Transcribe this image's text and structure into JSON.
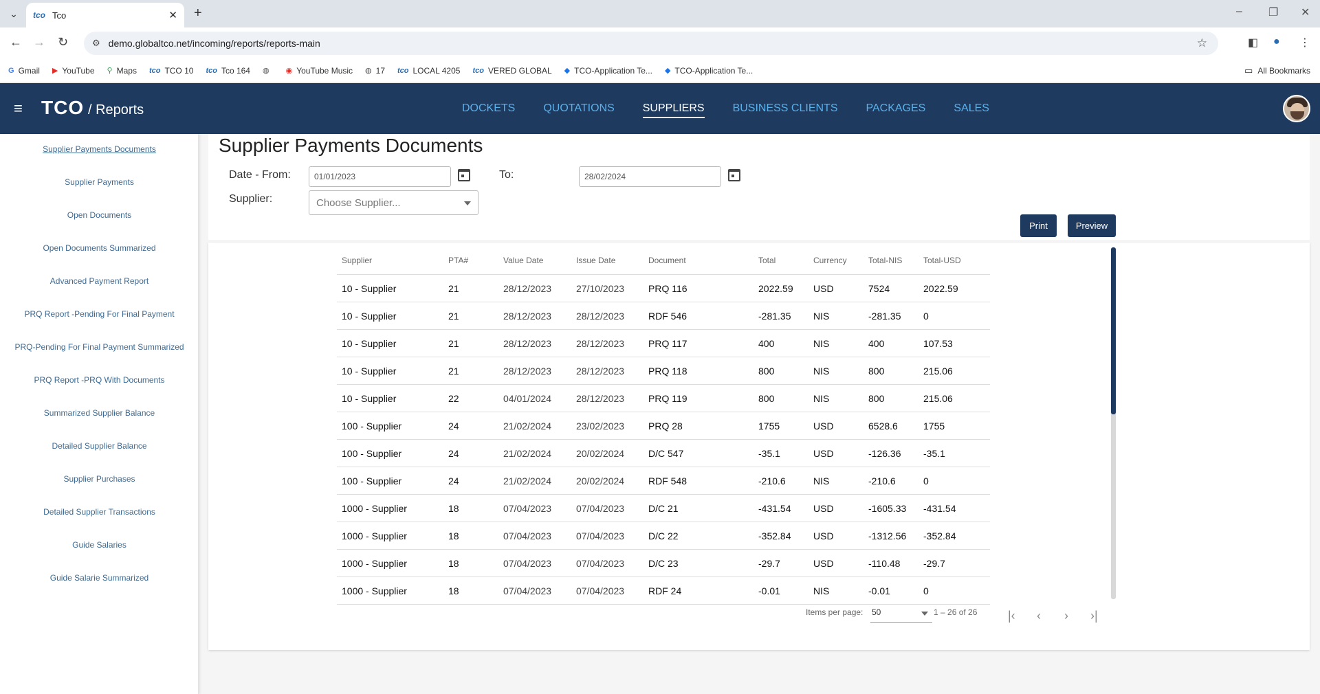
{
  "browser": {
    "tab_title": "Tco",
    "tab_favicon": "tco",
    "url": "demo.globaltco.net/incoming/reports/reports-main",
    "bookmarks": [
      {
        "label": "Gmail",
        "icon": "G"
      },
      {
        "label": "YouTube",
        "icon": "▶"
      },
      {
        "label": "Maps",
        "icon": "⚲"
      },
      {
        "label": "TCO 10",
        "icon": "tco"
      },
      {
        "label": "Tco 164",
        "icon": "tco"
      },
      {
        "label": "",
        "icon": "◍"
      },
      {
        "label": "YouTube Music",
        "icon": "◉"
      },
      {
        "label": "17",
        "icon": "◍"
      },
      {
        "label": "LOCAL 4205",
        "icon": "tco"
      },
      {
        "label": "VERED GLOBAL",
        "icon": "tco"
      },
      {
        "label": "TCO-Application Te...",
        "icon": "◆"
      },
      {
        "label": "TCO-Application Te...",
        "icon": "◆"
      }
    ],
    "all_bookmarks": "All Bookmarks"
  },
  "header": {
    "brand": "TCO",
    "section": "/ Reports",
    "nav": [
      {
        "label": "DOCKETS",
        "active": false
      },
      {
        "label": "QUOTATIONS",
        "active": false
      },
      {
        "label": "SUPPLIERS",
        "active": true
      },
      {
        "label": "BUSINESS CLIENTS",
        "active": false
      },
      {
        "label": "PACKAGES",
        "active": false
      },
      {
        "label": "SALES",
        "active": false
      }
    ]
  },
  "sidebar": {
    "items": [
      {
        "label": "Supplier Payments Documents",
        "active": true
      },
      {
        "label": "Supplier Payments",
        "active": false
      },
      {
        "label": "Open Documents",
        "active": false
      },
      {
        "label": "Open Documents Summarized",
        "active": false
      },
      {
        "label": "Advanced Payment Report",
        "active": false
      },
      {
        "label": "PRQ Report -Pending For Final Payment",
        "active": false
      },
      {
        "label": "PRQ-Pending For Final Payment Summarized",
        "active": false
      },
      {
        "label": "PRQ Report -PRQ With Documents",
        "active": false
      },
      {
        "label": "Summarized Supplier Balance",
        "active": false
      },
      {
        "label": "Detailed Supplier Balance",
        "active": false
      },
      {
        "label": "Supplier Purchases",
        "active": false
      },
      {
        "label": "Detailed Supplier Transactions",
        "active": false
      },
      {
        "label": "Guide Salaries",
        "active": false
      },
      {
        "label": "Guide Salarie Summarized",
        "active": false
      }
    ]
  },
  "page": {
    "title": "Supplier Payments Documents",
    "date_from_label": "Date - From:",
    "date_from_value": "01/01/2023",
    "to_label": "To:",
    "date_to_value": "28/02/2024",
    "supplier_label": "Supplier:",
    "supplier_placeholder": "Choose Supplier...",
    "print_label": "Print",
    "preview_label": "Preview"
  },
  "table": {
    "columns": [
      "Supplier",
      "PTA#",
      "Value Date",
      "Issue Date",
      "Document",
      "Total",
      "Currency",
      "Total-NIS",
      "Total-USD"
    ],
    "rows": [
      [
        "10 - Supplier",
        "21",
        "28/12/2023",
        "27/10/2023",
        "PRQ 116",
        "2022.59",
        "USD",
        "7524",
        "2022.59"
      ],
      [
        "10 - Supplier",
        "21",
        "28/12/2023",
        "28/12/2023",
        "RDF 546",
        "-281.35",
        "NIS",
        "-281.35",
        "0"
      ],
      [
        "10 - Supplier",
        "21",
        "28/12/2023",
        "28/12/2023",
        "PRQ 117",
        "400",
        "NIS",
        "400",
        "107.53"
      ],
      [
        "10 - Supplier",
        "21",
        "28/12/2023",
        "28/12/2023",
        "PRQ 118",
        "800",
        "NIS",
        "800",
        "215.06"
      ],
      [
        "10 - Supplier",
        "22",
        "04/01/2024",
        "28/12/2023",
        "PRQ 119",
        "800",
        "NIS",
        "800",
        "215.06"
      ],
      [
        "100 - Supplier",
        "24",
        "21/02/2024",
        "23/02/2023",
        "PRQ 28",
        "1755",
        "USD",
        "6528.6",
        "1755"
      ],
      [
        "100 - Supplier",
        "24",
        "21/02/2024",
        "20/02/2024",
        "D/C 547",
        "-35.1",
        "USD",
        "-126.36",
        "-35.1"
      ],
      [
        "100 - Supplier",
        "24",
        "21/02/2024",
        "20/02/2024",
        "RDF 548",
        "-210.6",
        "NIS",
        "-210.6",
        "0"
      ],
      [
        "1000 - Supplier",
        "18",
        "07/04/2023",
        "07/04/2023",
        "D/C 21",
        "-431.54",
        "USD",
        "-1605.33",
        "-431.54"
      ],
      [
        "1000 - Supplier",
        "18",
        "07/04/2023",
        "07/04/2023",
        "D/C 22",
        "-352.84",
        "USD",
        "-1312.56",
        "-352.84"
      ],
      [
        "1000 - Supplier",
        "18",
        "07/04/2023",
        "07/04/2023",
        "D/C 23",
        "-29.7",
        "USD",
        "-110.48",
        "-29.7"
      ],
      [
        "1000 - Supplier",
        "18",
        "07/04/2023",
        "07/04/2023",
        "RDF 24",
        "-0.01",
        "NIS",
        "-0.01",
        "0"
      ]
    ]
  },
  "paginator": {
    "items_per_page_label": "Items per page:",
    "items_per_page_value": "50",
    "range_label": "1 – 26 of 26"
  },
  "colors": {
    "header_bg": "#1f3a5f",
    "nav_link": "#5ab0ea",
    "sidebar_link": "#3d6b93"
  }
}
